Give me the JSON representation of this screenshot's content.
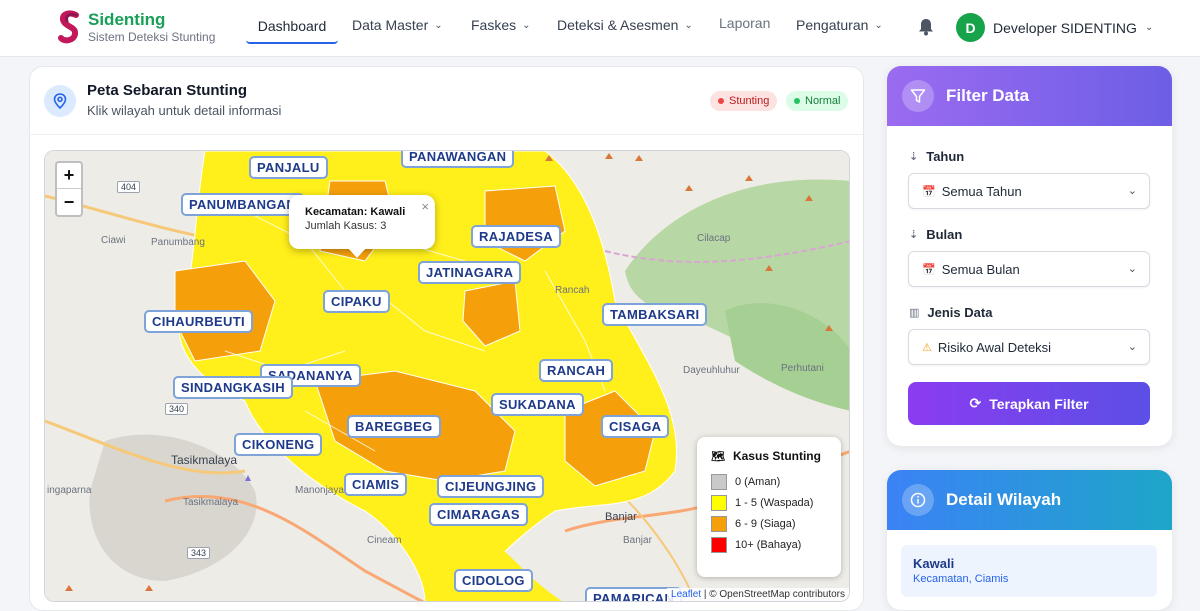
{
  "brand": {
    "title": "Sidenting",
    "subtitle": "Sistem Deteksi Stunting"
  },
  "nav": {
    "dashboard": "Dashboard",
    "data_master": "Data Master",
    "faskes": "Faskes",
    "deteksi": "Deteksi & Asesmen",
    "laporan": "Laporan",
    "pengaturan": "Pengaturan",
    "user_initial": "D",
    "user_name": "Developer SIDENTING"
  },
  "map_card": {
    "title": "Peta Sebaran Stunting",
    "subtitle": "Klik wilayah untuk detail informasi",
    "badge_stunting": "Stunting",
    "badge_normal": "Normal",
    "badge_colors": {
      "stunting": "#ef4444",
      "normal": "#22c55e"
    }
  },
  "map": {
    "zoom_in": "+",
    "zoom_out": "−",
    "labels": [
      "PANJALU",
      "PANAWANGAN",
      "PANUMBANGAN",
      "RAJADESA",
      "JATINAGARA",
      "CIPAKU",
      "CIHAURBEUTI",
      "TAMBAKSARI",
      "SADANANYA",
      "SINDANGKASIH",
      "RANCAH",
      "SUKADANA",
      "BAREGBEG",
      "CISAGA",
      "CIKONENG",
      "CIAMIS",
      "CIJEUNGJING",
      "CIMARAGAS",
      "CIDOLOG",
      "PAMARICAN"
    ],
    "basemap_text": [
      "Ciawi",
      "Panumbang",
      "Tasikmalaya",
      "ingaparna",
      "Manonjaya",
      "Tasikmalaya",
      "Cineam",
      "Banjar",
      "Banjar",
      "Dayeuhluhur",
      "Cilacap",
      "Rancah",
      "Perhutani"
    ],
    "road_numbers": [
      "404",
      "340",
      "343"
    ],
    "popup": {
      "line1": "Kecamatan: Kawali",
      "line2": "Jumlah Kasus: 3",
      "close": "×"
    },
    "legend": {
      "title": "Kasus Stunting",
      "items": [
        {
          "label": "0 (Aman)",
          "color": "#c9c9c9"
        },
        {
          "label": "1 - 5 (Waspada)",
          "color": "#ffff00"
        },
        {
          "label": "6 - 9 (Siaga)",
          "color": "#f5a00a"
        },
        {
          "label": "10+ (Bahaya)",
          "color": "#ff0000"
        }
      ]
    },
    "attribution_link": "Leaflet",
    "attribution_text": " | © OpenStreetMap contributors"
  },
  "filter": {
    "title": "Filter Data",
    "tahun_label": "Tahun",
    "tahun_value": "Semua Tahun",
    "bulan_label": "Bulan",
    "bulan_value": "Semua Bulan",
    "jenis_label": "Jenis Data",
    "jenis_value": "Risiko Awal Deteksi",
    "apply": "Terapkan Filter"
  },
  "detail": {
    "title": "Detail Wilayah",
    "name": "Kawali",
    "sub": "Kecamatan, Ciamis"
  }
}
